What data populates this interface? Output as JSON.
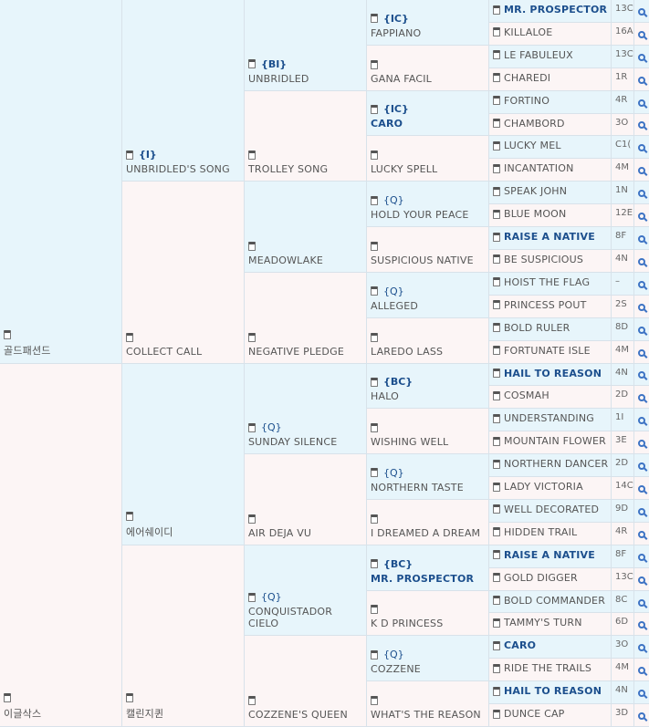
{
  "pedigree": {
    "gen1": [
      {
        "name": "골드패션드"
      },
      {
        "name": "이글삭스"
      }
    ],
    "gen2": [
      {
        "code": "{I}",
        "name": "UNBRIDLED'S SONG"
      },
      {
        "name": "COLLECT CALL"
      },
      {
        "name": "에어쉐이디"
      },
      {
        "name": "캘린지퀸"
      }
    ],
    "gen3": [
      {
        "code": "{BI}",
        "name": "UNBRIDLED"
      },
      {
        "name": "TROLLEY SONG"
      },
      {
        "name": "MEADOWLAKE"
      },
      {
        "name": "NEGATIVE PLEDGE"
      },
      {
        "code": "{Q}",
        "name": "SUNDAY SILENCE"
      },
      {
        "name": "AIR DEJA VU"
      },
      {
        "code": "{Q}",
        "name": "CONQUISTADOR CIELO"
      },
      {
        "name": "COZZENE'S QUEEN"
      }
    ],
    "gen4": [
      {
        "code": "{IC}",
        "name": "FAPPIANO"
      },
      {
        "name": "GANA FACIL"
      },
      {
        "code": "{IC}",
        "name": "CARO",
        "bold": true
      },
      {
        "name": "LUCKY SPELL"
      },
      {
        "code": "{Q}",
        "name": "HOLD YOUR PEACE"
      },
      {
        "name": "SUSPICIOUS NATIVE"
      },
      {
        "code": "{Q}",
        "name": "ALLEGED"
      },
      {
        "name": "LAREDO LASS"
      },
      {
        "code": "{BC}",
        "name": "HALO"
      },
      {
        "name": "WISHING WELL"
      },
      {
        "code": "{Q}",
        "name": "NORTHERN TASTE"
      },
      {
        "name": "I DREAMED A DREAM"
      },
      {
        "code": "{BC}",
        "name": "MR. PROSPECTOR",
        "bold": true
      },
      {
        "name": "K D PRINCESS"
      },
      {
        "code": "{Q}",
        "name": "COZZENE"
      },
      {
        "name": "WHAT'S THE REASON"
      }
    ],
    "gen5": [
      {
        "name": "MR. PROSPECTOR",
        "bold": true,
        "stat": "13C"
      },
      {
        "name": "KILLALOE",
        "stat": "16A"
      },
      {
        "name": "LE FABULEUX",
        "stat": "13C"
      },
      {
        "name": "CHAREDI",
        "stat": "1R"
      },
      {
        "name": "FORTINO",
        "stat": "4R"
      },
      {
        "name": "CHAMBORD",
        "stat": "3O"
      },
      {
        "name": "LUCKY MEL",
        "stat": "C1("
      },
      {
        "name": "INCANTATION",
        "stat": "4M"
      },
      {
        "name": "SPEAK JOHN",
        "stat": "1N"
      },
      {
        "name": "BLUE MOON",
        "stat": "12E"
      },
      {
        "name": "RAISE A NATIVE",
        "bold": true,
        "stat": "8F"
      },
      {
        "name": "BE SUSPICIOUS",
        "stat": "4N"
      },
      {
        "name": "HOIST THE FLAG",
        "stat": "–"
      },
      {
        "name": "PRINCESS POUT",
        "stat": "2S"
      },
      {
        "name": "BOLD RULER",
        "stat": "8D"
      },
      {
        "name": "FORTUNATE ISLE",
        "stat": "4M"
      },
      {
        "name": "HAIL TO REASON",
        "bold": true,
        "stat": "4N"
      },
      {
        "name": "COSMAH",
        "stat": "2D"
      },
      {
        "name": "UNDERSTANDING",
        "stat": "1I"
      },
      {
        "name": "MOUNTAIN FLOWER",
        "stat": "3E"
      },
      {
        "name": "NORTHERN DANCER",
        "stat": "2D"
      },
      {
        "name": "LADY VICTORIA",
        "stat": "14C"
      },
      {
        "name": "WELL DECORATED",
        "stat": "9D"
      },
      {
        "name": "HIDDEN TRAIL",
        "stat": "4R"
      },
      {
        "name": "RAISE A NATIVE",
        "bold": true,
        "stat": "8F"
      },
      {
        "name": "GOLD DIGGER",
        "stat": "13C"
      },
      {
        "name": "BOLD COMMANDER",
        "stat": "8C"
      },
      {
        "name": "TAMMY'S TURN",
        "stat": "6D"
      },
      {
        "name": "CARO",
        "bold": true,
        "stat": "3O"
      },
      {
        "name": "RIDE THE TRAILS",
        "stat": "4M"
      },
      {
        "name": "HAIL TO REASON",
        "bold": true,
        "stat": "4N"
      },
      {
        "name": "DUNCE CAP",
        "stat": "3D"
      }
    ]
  }
}
